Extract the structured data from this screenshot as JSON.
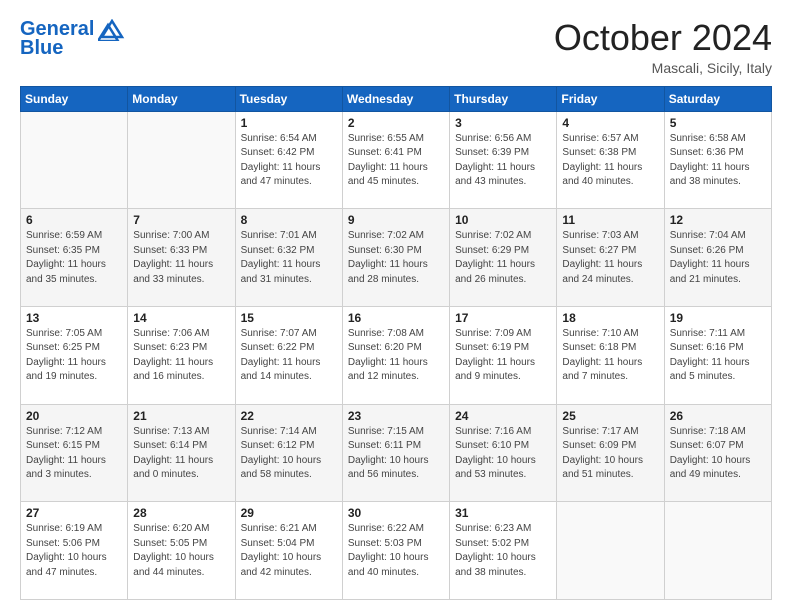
{
  "header": {
    "logo_line1": "General",
    "logo_line2": "Blue",
    "month": "October 2024",
    "location": "Mascali, Sicily, Italy"
  },
  "days_of_week": [
    "Sunday",
    "Monday",
    "Tuesday",
    "Wednesday",
    "Thursday",
    "Friday",
    "Saturday"
  ],
  "weeks": [
    [
      {
        "day": "",
        "info": ""
      },
      {
        "day": "",
        "info": ""
      },
      {
        "day": "1",
        "info": "Sunrise: 6:54 AM\nSunset: 6:42 PM\nDaylight: 11 hours and 47 minutes."
      },
      {
        "day": "2",
        "info": "Sunrise: 6:55 AM\nSunset: 6:41 PM\nDaylight: 11 hours and 45 minutes."
      },
      {
        "day": "3",
        "info": "Sunrise: 6:56 AM\nSunset: 6:39 PM\nDaylight: 11 hours and 43 minutes."
      },
      {
        "day": "4",
        "info": "Sunrise: 6:57 AM\nSunset: 6:38 PM\nDaylight: 11 hours and 40 minutes."
      },
      {
        "day": "5",
        "info": "Sunrise: 6:58 AM\nSunset: 6:36 PM\nDaylight: 11 hours and 38 minutes."
      }
    ],
    [
      {
        "day": "6",
        "info": "Sunrise: 6:59 AM\nSunset: 6:35 PM\nDaylight: 11 hours and 35 minutes."
      },
      {
        "day": "7",
        "info": "Sunrise: 7:00 AM\nSunset: 6:33 PM\nDaylight: 11 hours and 33 minutes."
      },
      {
        "day": "8",
        "info": "Sunrise: 7:01 AM\nSunset: 6:32 PM\nDaylight: 11 hours and 31 minutes."
      },
      {
        "day": "9",
        "info": "Sunrise: 7:02 AM\nSunset: 6:30 PM\nDaylight: 11 hours and 28 minutes."
      },
      {
        "day": "10",
        "info": "Sunrise: 7:02 AM\nSunset: 6:29 PM\nDaylight: 11 hours and 26 minutes."
      },
      {
        "day": "11",
        "info": "Sunrise: 7:03 AM\nSunset: 6:27 PM\nDaylight: 11 hours and 24 minutes."
      },
      {
        "day": "12",
        "info": "Sunrise: 7:04 AM\nSunset: 6:26 PM\nDaylight: 11 hours and 21 minutes."
      }
    ],
    [
      {
        "day": "13",
        "info": "Sunrise: 7:05 AM\nSunset: 6:25 PM\nDaylight: 11 hours and 19 minutes."
      },
      {
        "day": "14",
        "info": "Sunrise: 7:06 AM\nSunset: 6:23 PM\nDaylight: 11 hours and 16 minutes."
      },
      {
        "day": "15",
        "info": "Sunrise: 7:07 AM\nSunset: 6:22 PM\nDaylight: 11 hours and 14 minutes."
      },
      {
        "day": "16",
        "info": "Sunrise: 7:08 AM\nSunset: 6:20 PM\nDaylight: 11 hours and 12 minutes."
      },
      {
        "day": "17",
        "info": "Sunrise: 7:09 AM\nSunset: 6:19 PM\nDaylight: 11 hours and 9 minutes."
      },
      {
        "day": "18",
        "info": "Sunrise: 7:10 AM\nSunset: 6:18 PM\nDaylight: 11 hours and 7 minutes."
      },
      {
        "day": "19",
        "info": "Sunrise: 7:11 AM\nSunset: 6:16 PM\nDaylight: 11 hours and 5 minutes."
      }
    ],
    [
      {
        "day": "20",
        "info": "Sunrise: 7:12 AM\nSunset: 6:15 PM\nDaylight: 11 hours and 3 minutes."
      },
      {
        "day": "21",
        "info": "Sunrise: 7:13 AM\nSunset: 6:14 PM\nDaylight: 11 hours and 0 minutes."
      },
      {
        "day": "22",
        "info": "Sunrise: 7:14 AM\nSunset: 6:12 PM\nDaylight: 10 hours and 58 minutes."
      },
      {
        "day": "23",
        "info": "Sunrise: 7:15 AM\nSunset: 6:11 PM\nDaylight: 10 hours and 56 minutes."
      },
      {
        "day": "24",
        "info": "Sunrise: 7:16 AM\nSunset: 6:10 PM\nDaylight: 10 hours and 53 minutes."
      },
      {
        "day": "25",
        "info": "Sunrise: 7:17 AM\nSunset: 6:09 PM\nDaylight: 10 hours and 51 minutes."
      },
      {
        "day": "26",
        "info": "Sunrise: 7:18 AM\nSunset: 6:07 PM\nDaylight: 10 hours and 49 minutes."
      }
    ],
    [
      {
        "day": "27",
        "info": "Sunrise: 6:19 AM\nSunset: 5:06 PM\nDaylight: 10 hours and 47 minutes."
      },
      {
        "day": "28",
        "info": "Sunrise: 6:20 AM\nSunset: 5:05 PM\nDaylight: 10 hours and 44 minutes."
      },
      {
        "day": "29",
        "info": "Sunrise: 6:21 AM\nSunset: 5:04 PM\nDaylight: 10 hours and 42 minutes."
      },
      {
        "day": "30",
        "info": "Sunrise: 6:22 AM\nSunset: 5:03 PM\nDaylight: 10 hours and 40 minutes."
      },
      {
        "day": "31",
        "info": "Sunrise: 6:23 AM\nSunset: 5:02 PM\nDaylight: 10 hours and 38 minutes."
      },
      {
        "day": "",
        "info": ""
      },
      {
        "day": "",
        "info": ""
      }
    ]
  ]
}
